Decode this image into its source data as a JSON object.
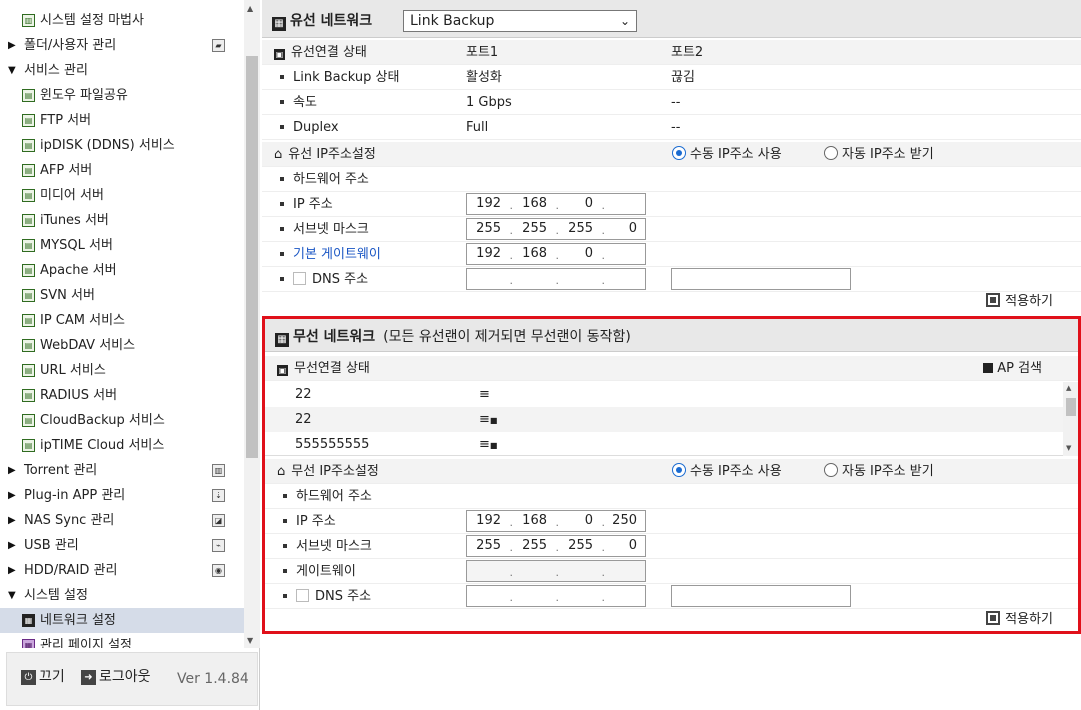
{
  "sidebar": {
    "top_partial": "—",
    "items": [
      {
        "label": "시스템 설정 마법사",
        "indent": 1,
        "icon": "wizard-icon",
        "arrow": ""
      },
      {
        "label": "폴더/사용자 관리",
        "indent": 0,
        "arrow": "▶",
        "right_icon": "folder-icon"
      },
      {
        "label": "서비스 관리",
        "indent": 0,
        "arrow": "▼"
      },
      {
        "label": "윈도우 파일공유",
        "indent": 1,
        "icon": "service-icon"
      },
      {
        "label": "FTP 서버",
        "indent": 1,
        "icon": "service-icon"
      },
      {
        "label": "ipDISK (DDNS) 서비스",
        "indent": 1,
        "icon": "service-icon"
      },
      {
        "label": "AFP 서버",
        "indent": 1,
        "icon": "service-icon"
      },
      {
        "label": "미디어 서버",
        "indent": 1,
        "icon": "service-icon"
      },
      {
        "label": "iTunes 서버",
        "indent": 1,
        "icon": "service-icon"
      },
      {
        "label": "MYSQL 서버",
        "indent": 1,
        "icon": "service-icon"
      },
      {
        "label": "Apache 서버",
        "indent": 1,
        "icon": "service-icon"
      },
      {
        "label": "SVN 서버",
        "indent": 1,
        "icon": "service-icon"
      },
      {
        "label": "IP CAM 서비스",
        "indent": 1,
        "icon": "service-icon"
      },
      {
        "label": "WebDAV 서비스",
        "indent": 1,
        "icon": "service-icon"
      },
      {
        "label": "URL 서비스",
        "indent": 1,
        "icon": "service-icon"
      },
      {
        "label": "RADIUS 서버",
        "indent": 1,
        "icon": "service-icon"
      },
      {
        "label": "CloudBackup 서비스",
        "indent": 1,
        "icon": "service-icon"
      },
      {
        "label": "ipTIME Cloud 서비스",
        "indent": 1,
        "icon": "service-icon"
      },
      {
        "label": "Torrent 관리",
        "indent": 0,
        "arrow": "▶",
        "right_icon": "torrent-icon"
      },
      {
        "label": "Plug-in APP 관리",
        "indent": 0,
        "arrow": "▶",
        "right_icon": "plugin-icon"
      },
      {
        "label": "NAS Sync 관리",
        "indent": 0,
        "arrow": "▶",
        "right_icon": "sync-icon"
      },
      {
        "label": "USB 관리",
        "indent": 0,
        "arrow": "▶",
        "right_icon": "usb-icon"
      },
      {
        "label": "HDD/RAID 관리",
        "indent": 0,
        "arrow": "▶",
        "right_icon": "hdd-icon"
      },
      {
        "label": "시스템 설정",
        "indent": 0,
        "arrow": "▼"
      },
      {
        "label": "네트워크 설정",
        "indent": 1,
        "icon": "network-icon",
        "selected": true
      },
      {
        "label": "관리 페이지 설정",
        "indent": 1,
        "icon": "admin-icon"
      }
    ],
    "footer": {
      "power_label": "끄기",
      "logout_label": "로그아웃",
      "version": "Ver 1.4.84"
    }
  },
  "wired": {
    "title": "유선 네트워크",
    "mode_select": "Link Backup",
    "status_header": {
      "label": "유선연결 상태",
      "port1": "포트1",
      "port2": "포트2"
    },
    "status_rows": [
      {
        "label": "Link Backup 상태",
        "port1": "활성화",
        "port2": "끊김"
      },
      {
        "label": "속도",
        "port1": "1 Gbps",
        "port2": "--"
      },
      {
        "label": "Duplex",
        "port1": "Full",
        "port2": "--"
      }
    ],
    "ip_header": "유선 IP주소설정",
    "manual_ip": "수동 IP주소 사용",
    "auto_ip": "자동 IP주소 받기",
    "hw_addr_label": "하드웨어 주소",
    "ip_label": "IP 주소",
    "ip": [
      "192",
      "168",
      "0",
      ""
    ],
    "subnet_label": "서브넷 마스크",
    "subnet": [
      "255",
      "255",
      "255",
      "0"
    ],
    "gateway_label": "기본 게이트웨이",
    "gateway": [
      "192",
      "168",
      "0",
      ""
    ],
    "dns_label": "DNS 주소",
    "apply": "적용하기"
  },
  "wireless": {
    "title": "무선 네트워크",
    "subtitle": "(모든 유선랜이 제거되면 무선랜이 동작함)",
    "status_label": "무선연결 상태",
    "ap_search": "AP 검색",
    "networks": [
      {
        "ssid": "22",
        "signal": "wifi-icon"
      },
      {
        "ssid": "22",
        "signal": "wifi-lock-icon"
      },
      {
        "ssid": "555555555",
        "signal": "wifi-lock-icon"
      }
    ],
    "ip_header": "무선 IP주소설정",
    "manual_ip": "수동 IP주소 사용",
    "auto_ip": "자동 IP주소 받기",
    "hw_addr_label": "하드웨어 주소",
    "ip_label": "IP 주소",
    "ip": [
      "192",
      "168",
      "0",
      "250"
    ],
    "subnet_label": "서브넷 마스크",
    "subnet": [
      "255",
      "255",
      "255",
      "0"
    ],
    "gateway_label": "게이트웨이",
    "gateway": [
      "",
      "",
      "",
      ""
    ],
    "dns_label": "DNS 주소",
    "apply": "적용하기"
  },
  "colors": {
    "highlight_border": "#e0101a",
    "radio_accent": "#1a6bd1",
    "link_blue": "#1a56c4",
    "selected_row": "#d5dce8"
  }
}
